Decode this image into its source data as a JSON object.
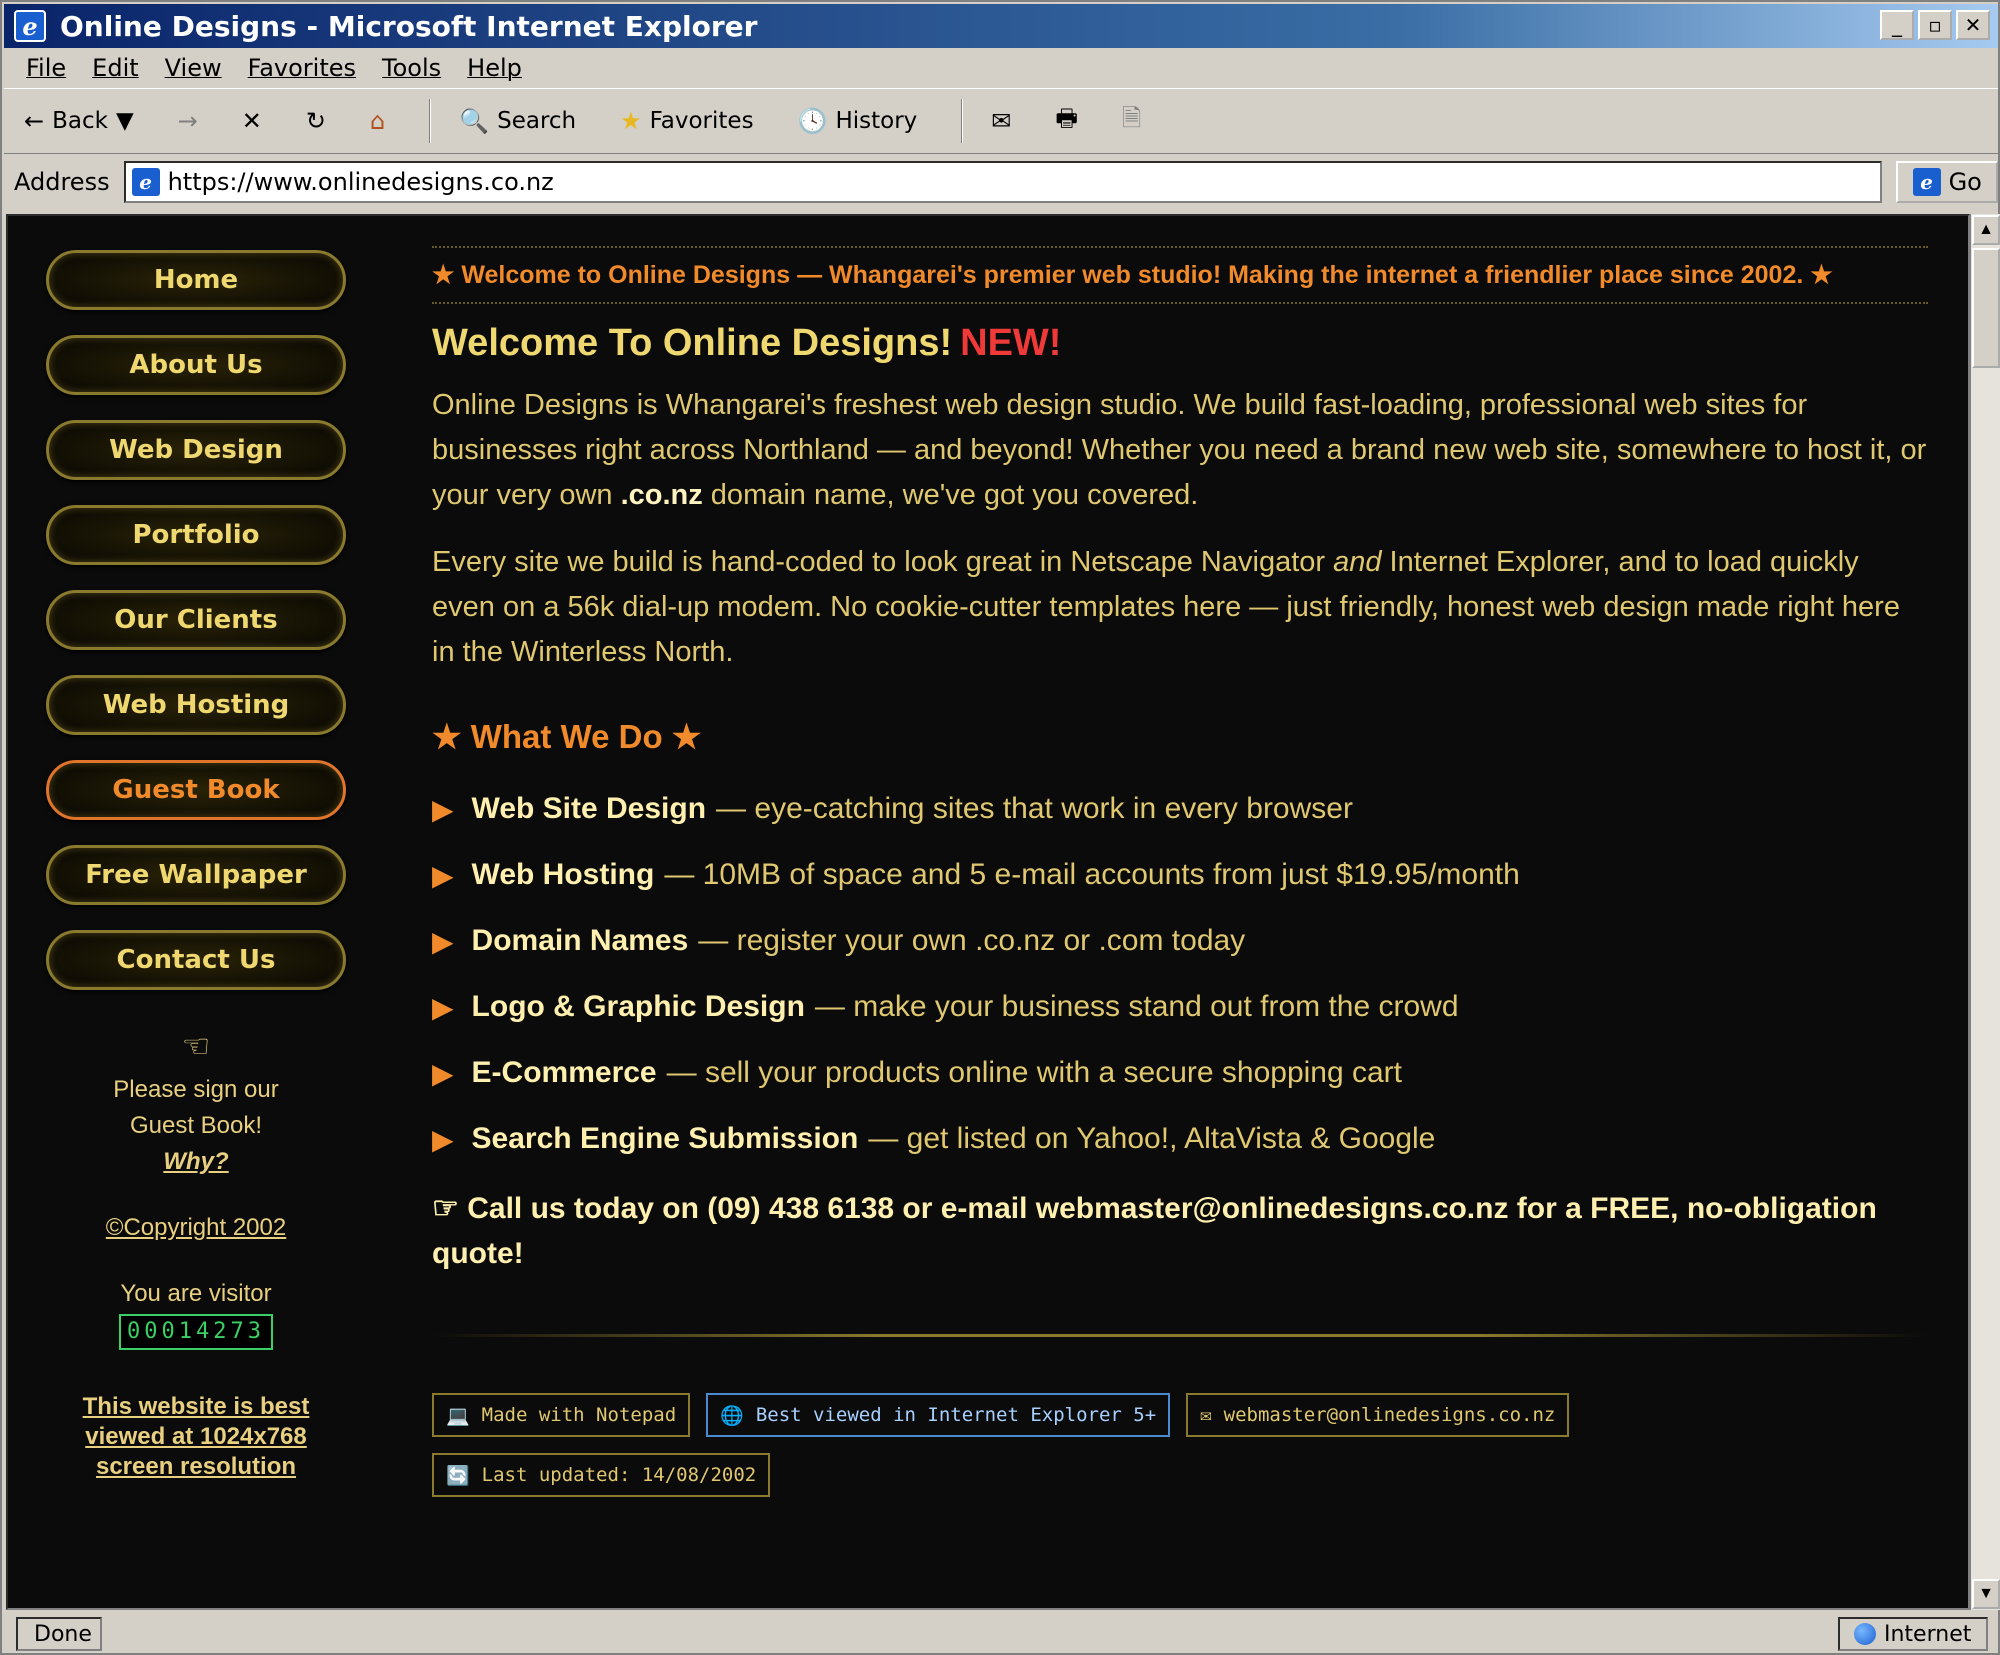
{
  "window": {
    "title": "Online Designs - Microsoft Internet Explorer",
    "buttons": [
      "_",
      "▫",
      "✕"
    ]
  },
  "menu": [
    "File",
    "Edit",
    "View",
    "Favorites",
    "Tools",
    "Help"
  ],
  "toolbar": {
    "back": "Back",
    "search": "Search",
    "favorites": "Favorites",
    "history": "History"
  },
  "address": {
    "label": "Address",
    "url": "https://www.onlinedesigns.co.nz",
    "go": "Go"
  },
  "sidebar": {
    "nav": [
      {
        "label": "Home",
        "active": false
      },
      {
        "label": "About Us",
        "active": false
      },
      {
        "label": "Web Design",
        "active": false
      },
      {
        "label": "Portfolio",
        "active": false
      },
      {
        "label": "Our Clients",
        "active": false
      },
      {
        "label": "Web Hosting",
        "active": false
      },
      {
        "label": "Guest Book",
        "active": true
      },
      {
        "label": "Free Wallpaper",
        "active": false
      },
      {
        "label": "Contact Us",
        "active": false
      }
    ],
    "sign_line1": "Please sign our",
    "sign_line2": "Guest Book!",
    "why": "Why?",
    "copyright": "©Copyright 2002",
    "visitor_text": "You are visitor",
    "counter": "00014273",
    "best_viewed": "This website is best viewed at 1024x768 screen resolution"
  },
  "main": {
    "marquee": "★ Welcome to Online Designs — Whangarei's premier web studio! Making the internet a friendlier place since 2002. ★",
    "heading": "Welcome To Online Designs!",
    "heading_new": "NEW!",
    "para1_a": "Online Designs is Whangarei's freshest web design studio. We build fast-loading, professional web sites for businesses right across Northland — and beyond! Whether you need a brand new web site, somewhere to host it, or your very own ",
    "para1_b": ".co.nz",
    "para1_c": " domain name, we've got you covered.",
    "para2_a": "Every site we build is hand-coded to look great in Netscape Navigator ",
    "para2_b": "and",
    "para2_c": " Internet Explorer, and to load quickly even on a 56k dial-up modem. No cookie-cutter templates here — just friendly, honest web design made right here in the Winterless North.",
    "section_title": "★ What We Do ★",
    "services": [
      {
        "name": "Web Site Design",
        "desc": "— eye-catching sites that work in every browser"
      },
      {
        "name": "Web Hosting",
        "desc": "— 10MB of space and 5 e-mail accounts from just $19.95/month"
      },
      {
        "name": "Domain Names",
        "desc": "— register your own .co.nz or .com today"
      },
      {
        "name": "Logo & Graphic Design",
        "desc": "— make your business stand out from the crowd"
      },
      {
        "name": "E-Commerce",
        "desc": "— sell your products online with a secure shopping cart"
      },
      {
        "name": "Search Engine Submission",
        "desc": "— get listed on Yahoo!, AltaVista & Google"
      }
    ],
    "call": "☞ Call us today on (09) 438 6138 or e-mail webmaster@onlinedesigns.co.nz for a FREE, no-obligation quote!",
    "badges": [
      {
        "icon": "💻",
        "text": "Made with Notepad",
        "style": "normal"
      },
      {
        "icon": "🌐",
        "text": "Best viewed in Internet Explorer 5+",
        "style": "ie"
      },
      {
        "icon": "✉",
        "text": "webmaster@onlinedesigns.co.nz",
        "style": "normal"
      },
      {
        "icon": "🔄",
        "text": "Last updated: 14/08/2002",
        "style": "normal"
      }
    ]
  },
  "status": {
    "left": "Done",
    "right": "Internet"
  }
}
